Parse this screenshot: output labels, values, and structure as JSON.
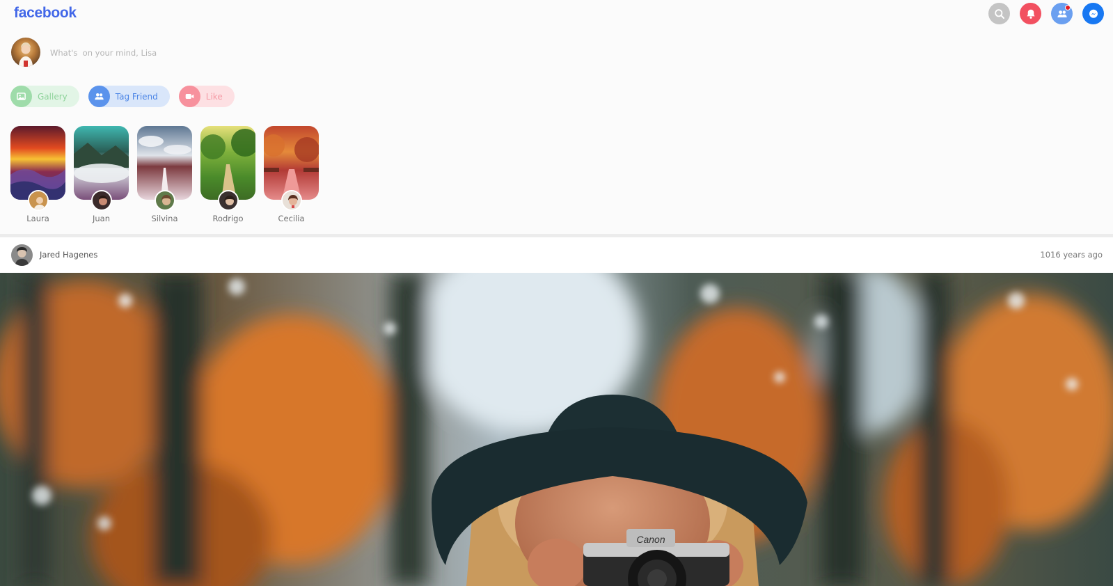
{
  "header": {
    "logo": "facebook",
    "logo_color": "#4267e8",
    "icons": [
      {
        "name": "search-icon",
        "bg": "#c4c4c4"
      },
      {
        "name": "bell-icon",
        "bg": "#f25060"
      },
      {
        "name": "friends-icon",
        "bg": "#6a9ff0",
        "has_badge": true,
        "badge_color": "#e31b23"
      },
      {
        "name": "messenger-icon",
        "bg": "#1878f2"
      }
    ]
  },
  "composer": {
    "placeholder": "What's  on your mind, Lisa",
    "chips": [
      {
        "label": "Gallery",
        "icon": "gallery-icon",
        "bg": "#e2f5e6",
        "icon_bg": "#9fdcaa",
        "text_color": "#8fd39b"
      },
      {
        "label": "Tag Friend",
        "icon": "friends-icon",
        "bg": "#d9e6fa",
        "icon_bg": "#5b93ec",
        "text_color": "#4d86e6"
      },
      {
        "label": "Like",
        "icon": "video-icon",
        "bg": "#fde0e3",
        "icon_bg": "#f7919d",
        "text_color": "#f59aa5"
      }
    ]
  },
  "stories": [
    {
      "name": "Laura"
    },
    {
      "name": "Juan"
    },
    {
      "name": "Silvina"
    },
    {
      "name": "Rodrigo"
    },
    {
      "name": "Cecilia"
    }
  ],
  "post": {
    "author": "Jared Hagenes",
    "time": "1016 years ago"
  }
}
